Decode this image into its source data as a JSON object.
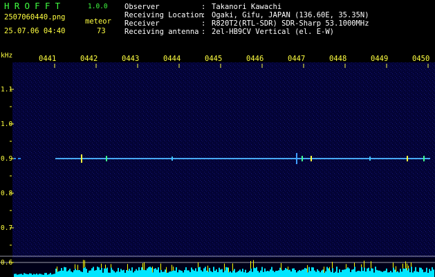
{
  "header": {
    "brand": "HROFFT",
    "version": "1.0.0",
    "filename": "2507060440.png",
    "datetime": "25.07.06 04:40",
    "meteor_label": "meteor",
    "meteor_count": "73"
  },
  "info": [
    {
      "label": "Observer",
      "value": "Takanori Kawachi"
    },
    {
      "label": "Receiving Location",
      "value": "Ogaki, Gifu, JAPAN (136.60E, 35.35N)"
    },
    {
      "label": "Receiver",
      "value": "R820T2(RTL-SDR) SDR-Sharp 53.1000MHz"
    },
    {
      "label": "Receiving antenna",
      "value": "2el-HB9CV Vertical (el. E-W)"
    }
  ],
  "chart_data": {
    "type": "heatmap",
    "ylabel": "kHz",
    "yticks": [
      "1.1",
      "1.0",
      "0.9",
      "0.8",
      "0.7",
      "0.6"
    ],
    "xticks": [
      "0441",
      "0442",
      "0443",
      "0444",
      "0445",
      "0446",
      "0447",
      "0448",
      "0449",
      "0450"
    ],
    "beacon_khz": 0.9,
    "colors": {
      "background": "#000033",
      "trace": "#2a8cff",
      "echo": "#ffff00",
      "level_bar": "#00e5ff"
    }
  }
}
